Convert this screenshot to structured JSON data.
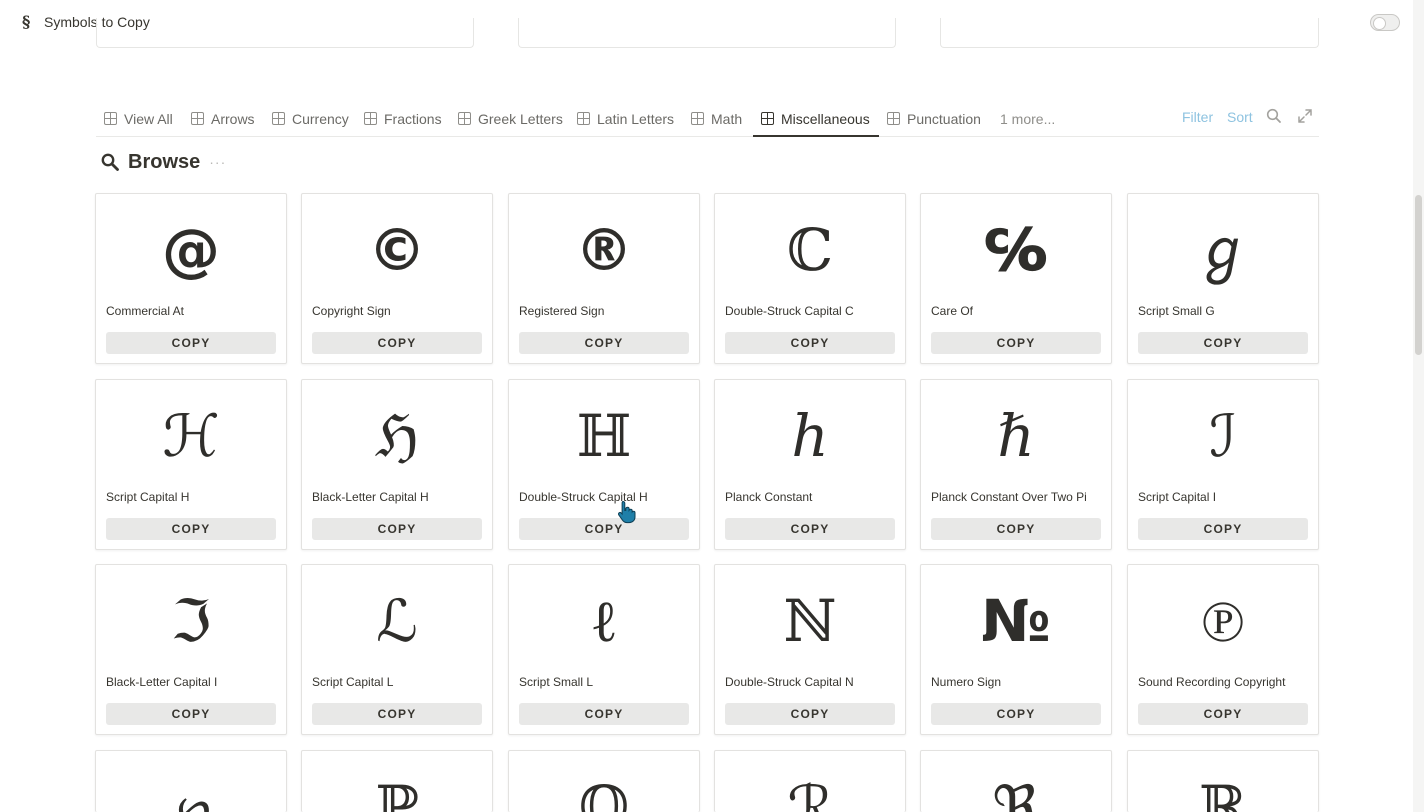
{
  "page": {
    "icon": "§",
    "title": "Symbols to Copy",
    "toggle_on": false
  },
  "tabs": [
    {
      "label": "View All",
      "icon": "table-icon"
    },
    {
      "label": "Arrows",
      "icon": "table-icon"
    },
    {
      "label": "Currency",
      "icon": "table-icon"
    },
    {
      "label": "Fractions",
      "icon": "table-icon"
    },
    {
      "label": "Greek Letters",
      "icon": "table-icon"
    },
    {
      "label": "Latin Letters",
      "icon": "table-icon"
    },
    {
      "label": "Math",
      "icon": "table-icon"
    },
    {
      "label": "Miscellaneous",
      "icon": "table-icon",
      "active": true
    },
    {
      "label": "Punctuation",
      "icon": "table-icon"
    }
  ],
  "more_tabs": "1 more...",
  "toolbar": {
    "filter": "Filter",
    "sort": "Sort",
    "search_icon": "search-icon",
    "expand_icon": "expand-icon"
  },
  "browse": {
    "title": "Browse",
    "icon": "search-icon",
    "menu": "···"
  },
  "copy_label": "COPY",
  "cards": [
    {
      "glyph": "@",
      "name": "Commercial At"
    },
    {
      "glyph": "©",
      "name": "Copyright Sign"
    },
    {
      "glyph": "®",
      "name": "Registered Sign"
    },
    {
      "glyph": "ℂ",
      "name": "Double-Struck Capital C"
    },
    {
      "glyph": "℅",
      "name": "Care Of"
    },
    {
      "glyph": "ℊ",
      "name": "Script Small G"
    },
    {
      "glyph": "ℋ",
      "name": "Script Capital H"
    },
    {
      "glyph": "ℌ",
      "name": "Black-Letter Capital H"
    },
    {
      "glyph": "ℍ",
      "name": "Double-Struck Capital H"
    },
    {
      "glyph": "ℎ",
      "name": "Planck Constant"
    },
    {
      "glyph": "ℏ",
      "name": "Planck Constant Over Two Pi"
    },
    {
      "glyph": "ℐ",
      "name": "Script Capital I"
    },
    {
      "glyph": "ℑ",
      "name": "Black-Letter Capital I"
    },
    {
      "glyph": "ℒ",
      "name": "Script Capital L"
    },
    {
      "glyph": "ℓ",
      "name": "Script Small L"
    },
    {
      "glyph": "ℕ",
      "name": "Double-Struck Capital N"
    },
    {
      "glyph": "№",
      "name": "Numero Sign"
    },
    {
      "glyph": "℗",
      "name": "Sound Recording Copyright"
    },
    {
      "glyph": "℘",
      "name": ""
    },
    {
      "glyph": "ℙ",
      "name": ""
    },
    {
      "glyph": "ℚ",
      "name": ""
    },
    {
      "glyph": "ℛ",
      "name": ""
    },
    {
      "glyph": "ℜ",
      "name": ""
    },
    {
      "glyph": "ℝ",
      "name": ""
    }
  ]
}
